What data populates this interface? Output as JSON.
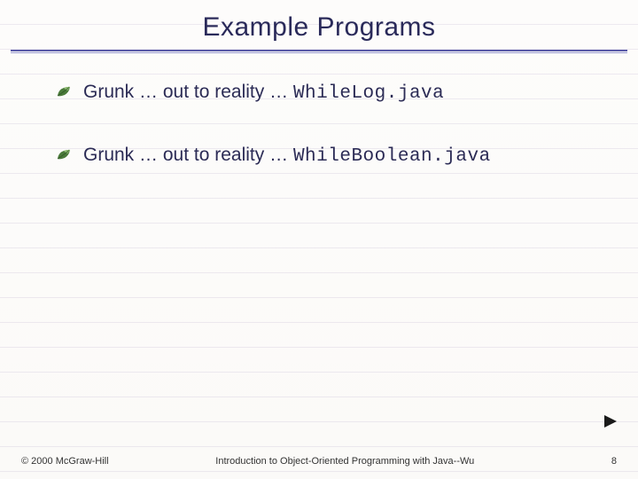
{
  "title": "Example Programs",
  "bullets": [
    {
      "lead": "Grunk … out to reality …",
      "code": "WhileLog.java"
    },
    {
      "lead": "Grunk … out to reality …",
      "code": "WhileBoolean.java"
    }
  ],
  "footer": {
    "copyright": "© 2000 McGraw-Hill",
    "center": "Introduction to Object-Oriented Programming with Java--Wu",
    "page": "8"
  },
  "icons": {
    "bullet": "leaf-bullet-icon",
    "play": "play-icon"
  },
  "colors": {
    "heading": "#2a2a5a",
    "rule": "#5a5aa8",
    "leaf_fill": "#4a7a3a",
    "leaf_tip": "#8fbc72",
    "play": "#1a1a1a"
  }
}
